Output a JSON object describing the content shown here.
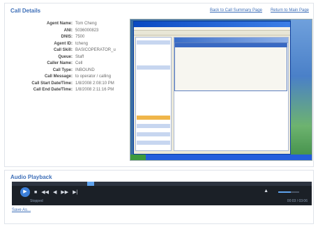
{
  "call_details": {
    "header": "Call Details",
    "links": {
      "back_summary": "Back to Call Summary Page",
      "return_main": "Return to Main Page"
    },
    "rows": [
      {
        "label": "Agent Name:",
        "value": "Tom Cheng"
      },
      {
        "label": "ANI:",
        "value": "5036000823"
      },
      {
        "label": "DNIS:",
        "value": "7500"
      },
      {
        "label": "Agent ID:",
        "value": "tcheng"
      },
      {
        "label": "Call Skill:",
        "value": "BASICOPERATOR_u"
      },
      {
        "label": "Queue:",
        "value": "Staff"
      },
      {
        "label": "Caller Name:",
        "value": "Cell"
      },
      {
        "label": "Call Type:",
        "value": "INBOUND"
      },
      {
        "label": "Call Message:",
        "value": "to operator / calling"
      },
      {
        "label": "Call Start Date/Time:",
        "value": "1/8/2008 2:08:10 PM"
      },
      {
        "label": "Call End Date/Time:",
        "value": "1/8/2008 2:11:16 PM"
      }
    ]
  },
  "audio": {
    "header": "Audio Playback",
    "status": "Stopped",
    "time": "00:03 / 03:06",
    "progress_fraction": 0.25,
    "volume_fraction": 0.6,
    "save_link": "Save As...",
    "icons": {
      "play": "play-icon",
      "stop": "stop-icon",
      "prev": "previous-icon",
      "rewind": "rewind-icon",
      "forward": "fast-forward-icon",
      "next": "next-icon",
      "volume": "volume-icon"
    }
  }
}
